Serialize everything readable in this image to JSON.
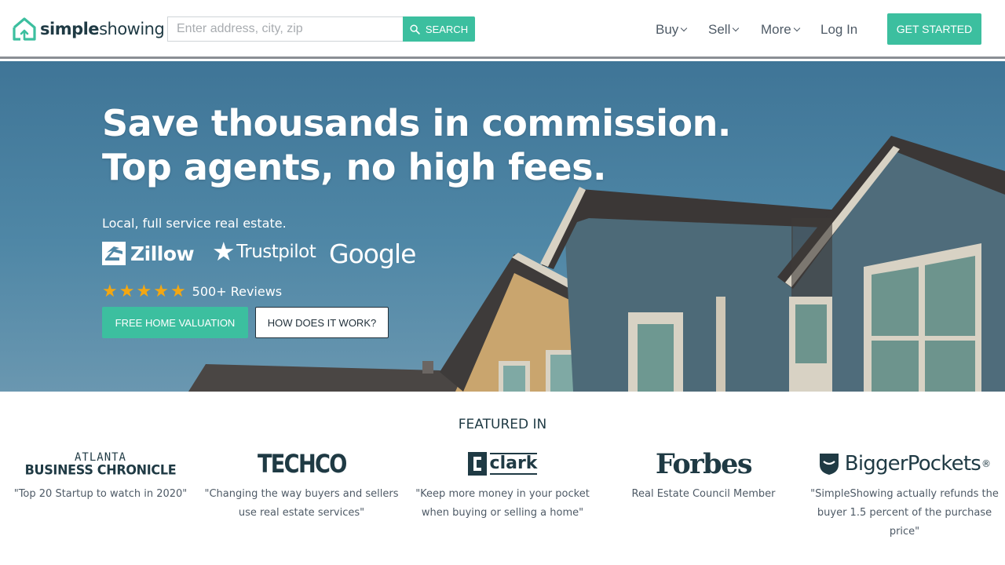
{
  "header": {
    "logo": {
      "bold": "simple",
      "regular": "showing"
    },
    "search": {
      "placeholder": "Enter address, city, zip",
      "button_label": "SEARCH"
    },
    "nav": [
      {
        "label": "Buy",
        "has_dropdown": true
      },
      {
        "label": "Sell",
        "has_dropdown": true
      },
      {
        "label": "More",
        "has_dropdown": true
      },
      {
        "label": "Log In",
        "has_dropdown": false
      }
    ],
    "cta_label": "GET STARTED"
  },
  "hero": {
    "title_line1": "Save thousands in commission.",
    "title_line2": "Top agents, no high fees.",
    "subtitle": "Local, full service real estate.",
    "brands": [
      "Zillow",
      "Trustpilot",
      "Google"
    ],
    "rating_stars": 5,
    "reviews_label": "500+ Reviews",
    "primary_button": "FREE HOME VALUATION",
    "secondary_button": "HOW DOES IT WORK?"
  },
  "featured": {
    "title": "FEATURED IN",
    "items": [
      {
        "logo_line1": "ATLANTA",
        "logo_line2": "BUSINESS CHRONICLE",
        "quote": "\"Top 20 Startup to watch in 2020\""
      },
      {
        "logo": "TECHCO",
        "quote": "\"Changing the way buyers and sellers use real estate services\""
      },
      {
        "logo": "clark",
        "quote": "\"Keep more money in your pocket when buying or selling a home\""
      },
      {
        "logo": "Forbes",
        "quote": "Real Estate Council Member"
      },
      {
        "logo": "BiggerPockets",
        "logo_mark": "®",
        "quote": "\"SimpleShowing actually refunds the buyer 1.5 percent of the purchase price\""
      }
    ]
  },
  "colors": {
    "accent": "#3cbf9f",
    "text_dark": "#1f3a44",
    "star": "#f3a712"
  }
}
